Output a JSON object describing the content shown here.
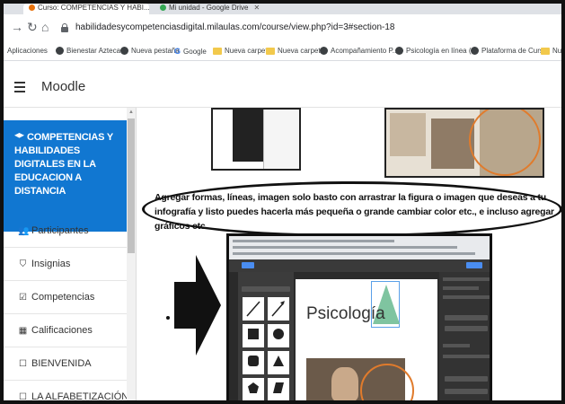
{
  "browser": {
    "tabs": [
      {
        "label": "Curso: COMPETENCIAS Y HABI...",
        "active": true
      },
      {
        "label": "Mi unidad - Google Drive",
        "active": false
      }
    ],
    "url": "habilidadesycompetenciasdigital.milaulas.com/course/view.php?id=3#section-18",
    "bookmarks": [
      {
        "label": "Aplicaciones",
        "icon": "apps-icon"
      },
      {
        "label": "Bienestar Azteca",
        "icon": "globe-icon"
      },
      {
        "label": "Nueva pestaña",
        "icon": "globe-icon"
      },
      {
        "label": "Google",
        "icon": "google-icon"
      },
      {
        "label": "Nueva carpeta",
        "icon": "folder-icon"
      },
      {
        "label": "Nueva carpeta",
        "icon": "folder-icon"
      },
      {
        "label": "Acompañamiento P...",
        "icon": "globe-icon"
      },
      {
        "label": "Psicología en línea (...",
        "icon": "globe-icon"
      },
      {
        "label": "Plataforma de Curs...",
        "icon": "globe-icon"
      },
      {
        "label": "Nueva",
        "icon": "folder-icon"
      }
    ]
  },
  "moodle": {
    "brand": "Moodle"
  },
  "sidebar": {
    "course": "COMPETENCIAS Y HABILIDADES DIGITALES EN LA EDUCACION A DISTANCIA",
    "items": [
      {
        "label": "Participantes",
        "icon": "users-icon"
      },
      {
        "label": "Insignias",
        "icon": "shield-icon"
      },
      {
        "label": "Competencias",
        "icon": "checkbox-icon"
      },
      {
        "label": "Calificaciones",
        "icon": "table-icon"
      },
      {
        "label": "BIENVENIDA",
        "icon": "folder-icon"
      },
      {
        "label": "LA ALFABETIZACIÓN",
        "icon": "folder-icon"
      }
    ]
  },
  "content": {
    "instruction": "Agregar formas, líneas, imagen solo basto con arrastrar la figura o imagen que deseas a tu infografía y listo puedes hacerla más pequeña o grande cambiar color etc., e incluso agregar gráficos etc.",
    "embedded_title": "Psicología"
  },
  "colors": {
    "course_block": "#1177d1",
    "accent_ring": "#e07b2c",
    "triangle": "#7fc4a0"
  }
}
